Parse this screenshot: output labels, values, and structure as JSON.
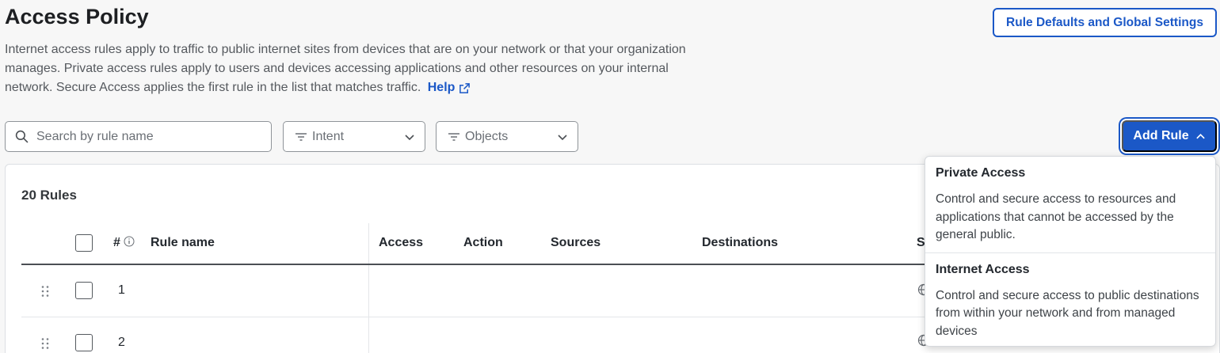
{
  "page": {
    "title": "Access Policy",
    "description": "Internet access rules apply to traffic to public internet sites from devices that are on your network or that your organization manages. Private access rules apply to users and devices accessing applications and other resources on your internal network. Secure Access applies the first rule in the list that matches traffic.",
    "help_label": "Help",
    "defaults_button": "Rule Defaults and Global Settings"
  },
  "toolbar": {
    "search_placeholder": "Search by rule name",
    "intent_filter": "Intent",
    "objects_filter": "Objects",
    "add_rule": "Add Rule"
  },
  "table": {
    "count_label": "20 Rules",
    "columns": {
      "number": "#",
      "rule_name": "Rule name",
      "access": "Access",
      "action": "Action",
      "sources": "Sources",
      "destinations": "Destinations",
      "truncated": "S"
    },
    "rows": [
      {
        "number": "1"
      },
      {
        "number": "2"
      }
    ]
  },
  "add_rule_menu": {
    "items": [
      {
        "title": "Private Access",
        "description": "Control and secure access to resources and applications that cannot be accessed by the general public."
      },
      {
        "title": "Internet Access",
        "description": "Control and secure access to public destinations from within your network and from managed devices"
      }
    ]
  },
  "colors": {
    "accent": "#1b58c7",
    "background": "#f7f7f7",
    "border": "#8f9499"
  },
  "icons": [
    "search-icon",
    "filter-icon",
    "chevron-down-icon",
    "chevron-up-icon",
    "external-link-icon",
    "info-icon",
    "drag-handle-icon",
    "globe-icon"
  ]
}
